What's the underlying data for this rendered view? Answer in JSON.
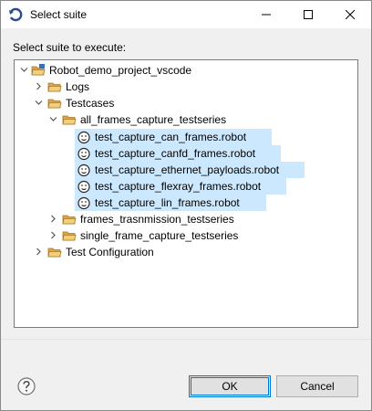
{
  "window": {
    "title": "Select suite",
    "app_icon": "eclipse-refresh-icon",
    "controls": [
      "minimize-icon",
      "maximize-icon",
      "close-icon"
    ]
  },
  "prompt": "Select suite to execute:",
  "tree": {
    "root": {
      "label": "Robot_demo_project_vscode",
      "expanded": true,
      "icon": "project-folder-icon"
    },
    "logs": {
      "label": "Logs",
      "expanded": false,
      "icon": "folder-icon"
    },
    "testcases": {
      "label": "Testcases",
      "expanded": true,
      "icon": "folder-icon"
    },
    "all_frames": {
      "label": "all_frames_capture_testseries",
      "expanded": true,
      "icon": "folder-icon"
    },
    "files": [
      {
        "label": "test_capture_can_frames.robot",
        "selected": true,
        "icon": "robot-file-icon"
      },
      {
        "label": "test_capture_canfd_frames.robot",
        "selected": true,
        "icon": "robot-file-icon"
      },
      {
        "label": "test_capture_ethernet_payloads.robot",
        "selected": true,
        "icon": "robot-file-icon"
      },
      {
        "label": "test_capture_flexray_frames.robot",
        "selected": true,
        "icon": "robot-file-icon"
      },
      {
        "label": "test_capture_lin_frames.robot",
        "selected": true,
        "icon": "robot-file-icon"
      }
    ],
    "frames_trans": {
      "label": "frames_trasnmission_testseries",
      "expanded": false,
      "icon": "folder-icon"
    },
    "single_frame": {
      "label": "single_frame_capture_testseries",
      "expanded": false,
      "icon": "folder-icon"
    },
    "test_config": {
      "label": "Test Configuration",
      "expanded": false,
      "icon": "folder-icon"
    }
  },
  "buttons": {
    "ok": "OK",
    "cancel": "Cancel",
    "help_icon": "help-icon"
  },
  "colors": {
    "selection": "#cce8ff",
    "accent": "#0078d7",
    "folder": "#e8b44a"
  }
}
